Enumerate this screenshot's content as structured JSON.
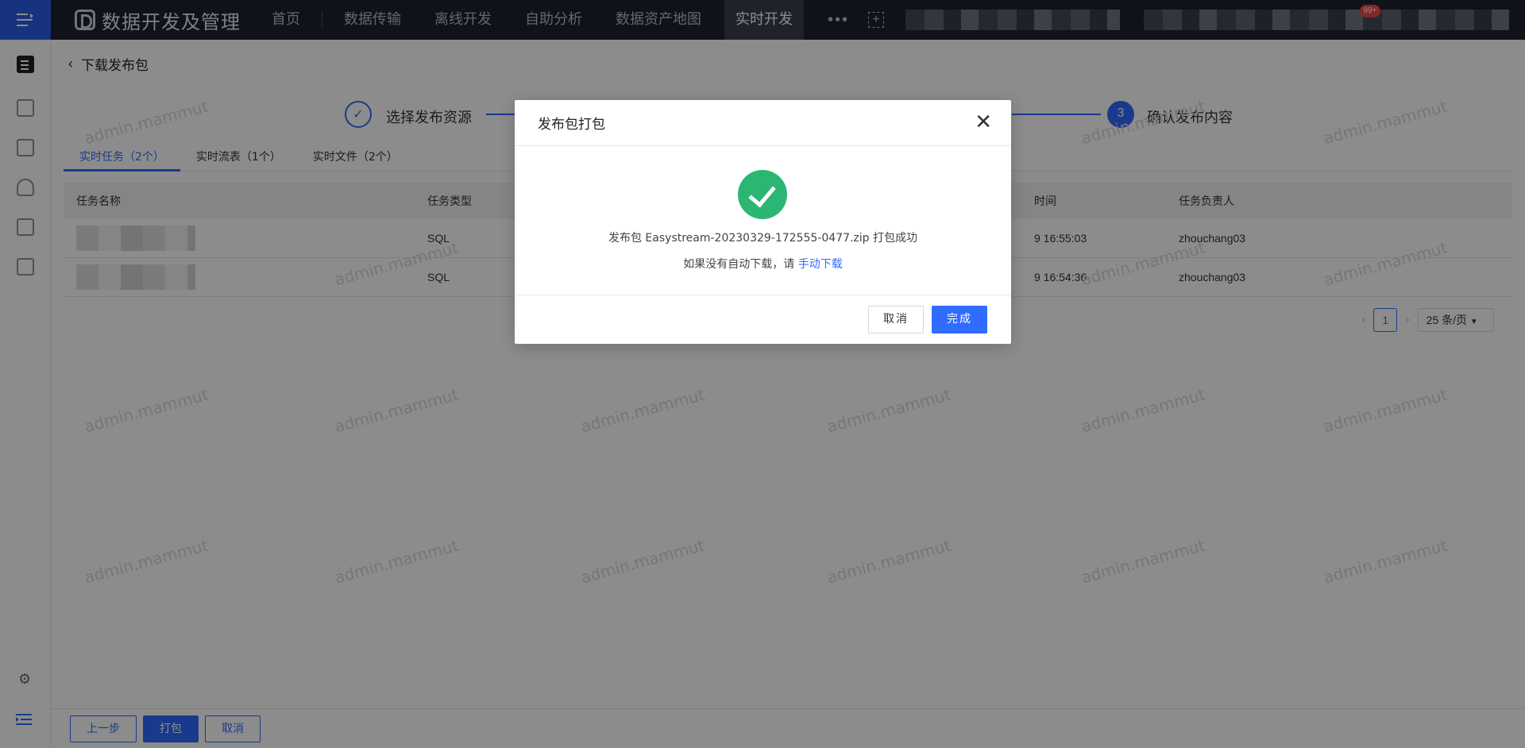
{
  "topnav": {
    "brand": "数据开发及管理",
    "items": [
      "首页",
      "数据传输",
      "离线开发",
      "自助分析",
      "数据资产地图"
    ],
    "active_item": "实时开发",
    "more": "•••",
    "badge": "99+"
  },
  "page": {
    "title": "下载发布包"
  },
  "steps": {
    "step1": "选择发布资源",
    "step3_number": "3",
    "step3": "确认发布内容"
  },
  "tabs": [
    "实时任务（2个）",
    "实时流表（1个）",
    "实时文件（2个）"
  ],
  "table": {
    "headers": [
      "任务名称",
      "任务类型",
      "时间",
      "任务负责人"
    ],
    "rows": [
      {
        "type": "SQL",
        "time": "9 16:55:03",
        "owner": "zhouchang03"
      },
      {
        "type": "SQL",
        "time": "9 16:54:36",
        "owner": "zhouchang03"
      }
    ]
  },
  "pagination": {
    "current": "1",
    "page_size": "25 条/页"
  },
  "footer": {
    "prev": "上一步",
    "pack": "打包",
    "cancel": "取消"
  },
  "watermark": "admin.mammut",
  "modal": {
    "title": "发布包打包",
    "message": "发布包 Easystream-20230329-172555-0477.zip 打包成功",
    "hint_prefix": "如果没有自动下载，请",
    "hint_link": "手动下载",
    "cancel": "取消",
    "ok": "完成"
  },
  "colors": {
    "primary": "#2f6bff",
    "success": "#2bb673",
    "nav_bg": "#1e2130"
  }
}
